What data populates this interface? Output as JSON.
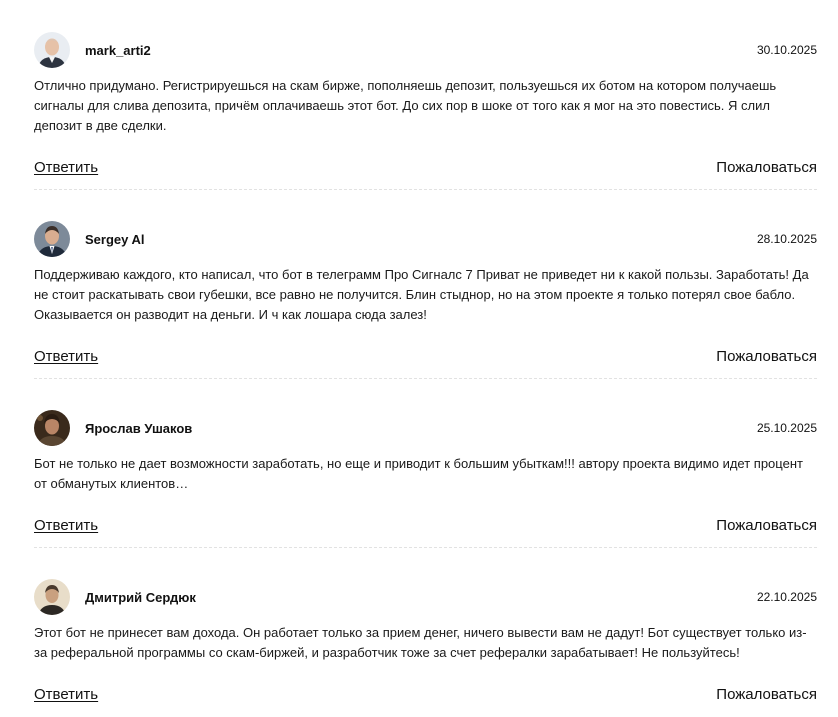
{
  "comments": [
    {
      "author": "mark_arti2",
      "date": "30.10.2025",
      "text": "Отлично придумано. Регистрируешься на скам бирже, пополняешь депозит, пользуешься их ботом на котором получаешь сигналы для слива депозита, причём оплачиваешь этот бот. До сих пор в шоке от того как я мог на это повестись. Я слил депозит в две сделки.",
      "reply_label": "Ответить",
      "report_label": "Пожаловаться",
      "avatar_icon": "user-photo-icon"
    },
    {
      "author": "Sergey Al",
      "date": "28.10.2025",
      "text": "Поддерживаю каждого, кто написал, что бот в телеграмм Про Сигналс 7 Приват не приведет ни к какой пользы. Заработать! Да не стоит раскатывать свои губешки, все равно не получится. Блин стыднор, но на этом проекте я только потерял свое бабло. Оказывается он разводит на деньги. И ч как лошара сюда залез!",
      "reply_label": "Ответить",
      "report_label": "Пожаловаться",
      "avatar_icon": "user-photo-icon"
    },
    {
      "author": "Ярослав Ушаков",
      "date": "25.10.2025",
      "text": "Бот не только не дает возможности заработать, но еще и приводит к большим убыткам!!! автору проекта видимо идет процент от обманутых клиентов…",
      "reply_label": "Ответить",
      "report_label": "Пожаловаться",
      "avatar_icon": "user-photo-icon"
    },
    {
      "author": "Дмитрий Сердюк",
      "date": "22.10.2025",
      "text": "Этот бот не принесет вам дохода. Он работает только за прием денег, ничего вывести вам не дадут! Бот существует только из-за реферальной программы со скам-биржей, и разработчик тоже за счет рефералки зарабатывает! Не пользуйтесь!",
      "reply_label": "Ответить",
      "report_label": "Пожаловаться",
      "avatar_icon": "user-photo-icon"
    }
  ]
}
